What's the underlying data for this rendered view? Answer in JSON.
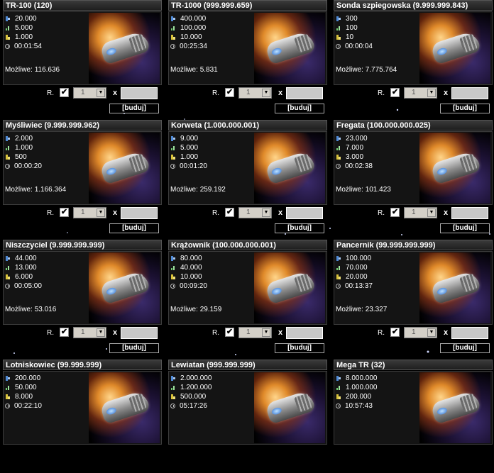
{
  "labels": {
    "possible_prefix": "Możliwe: ",
    "repeat": "R.",
    "times": "x",
    "build": "[buduj]",
    "check": "✔",
    "dropdown_arrow": "▼"
  },
  "icons": [
    "metal-icon",
    "crystal-icon",
    "deuterium-icon",
    "clock-icon"
  ],
  "ships": [
    {
      "title": "TR-100 (120)",
      "metal": "20.000",
      "crystal": "5.000",
      "deuterium": "1.000",
      "time": "00:01:54",
      "possible": "116.636",
      "qty_selected": "1"
    },
    {
      "title": "TR-1000 (999.999.659)",
      "metal": "400.000",
      "crystal": "100.000",
      "deuterium": "10.000",
      "time": "00:25:34",
      "possible": "5.831",
      "qty_selected": "1"
    },
    {
      "title": "Sonda szpiegowska (9.999.999.843)",
      "metal": "300",
      "crystal": "100",
      "deuterium": "10",
      "time": "00:00:04",
      "possible": "7.775.764",
      "qty_selected": "1"
    },
    {
      "title": "Myśliwiec (9.999.999.962)",
      "metal": "2.000",
      "crystal": "1.000",
      "deuterium": "500",
      "time": "00:00:20",
      "possible": "1.166.364",
      "qty_selected": "1"
    },
    {
      "title": "Korweta (1.000.000.001)",
      "metal": "9.000",
      "crystal": "5.000",
      "deuterium": "1.000",
      "time": "00:01:20",
      "possible": "259.192",
      "qty_selected": "1"
    },
    {
      "title": "Fregata (100.000.000.025)",
      "metal": "23.000",
      "crystal": "7.000",
      "deuterium": "3.000",
      "time": "00:02:38",
      "possible": "101.423",
      "qty_selected": "1"
    },
    {
      "title": "Niszczyciel (9.999.999.999)",
      "metal": "44.000",
      "crystal": "13.000",
      "deuterium": "6.000",
      "time": "00:05:00",
      "possible": "53.016",
      "qty_selected": "1"
    },
    {
      "title": "Krążownik (100.000.000.001)",
      "metal": "80.000",
      "crystal": "40.000",
      "deuterium": "10.000",
      "time": "00:09:20",
      "possible": "29.159",
      "qty_selected": "1"
    },
    {
      "title": "Pancernik (99.999.999.999)",
      "metal": "100.000",
      "crystal": "70.000",
      "deuterium": "20.000",
      "time": "00:13:37",
      "possible": "23.327",
      "qty_selected": "1"
    },
    {
      "title": "Lotniskowiec (99.999.999)",
      "metal": "200.000",
      "crystal": "50.000",
      "deuterium": "8.000",
      "time": "00:22:10",
      "possible": "",
      "qty_selected": ""
    },
    {
      "title": "Lewiatan (999.999.999)",
      "metal": "2.000.000",
      "crystal": "1.200.000",
      "deuterium": "500.000",
      "time": "05:17:26",
      "possible": "",
      "qty_selected": ""
    },
    {
      "title": "Mega TR (32)",
      "metal": "8.000.000",
      "crystal": "1.000.000",
      "deuterium": "200.000",
      "time": "10:57:43",
      "possible": "",
      "qty_selected": ""
    }
  ]
}
